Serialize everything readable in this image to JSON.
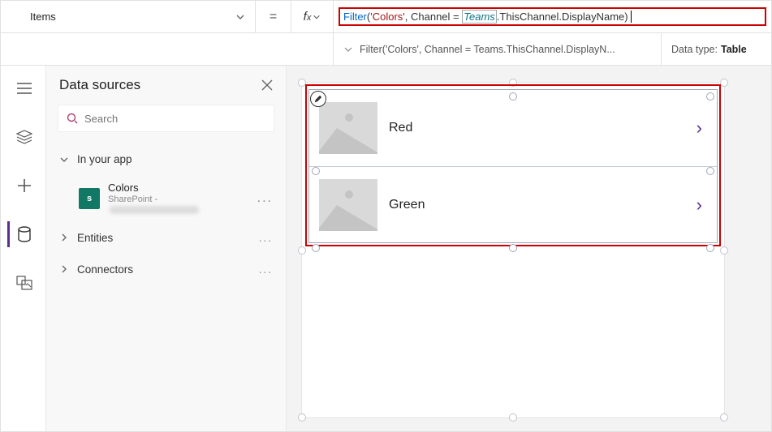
{
  "property": {
    "selected": "Items"
  },
  "formula": {
    "fn": "Filter",
    "arg1": "'Colors'",
    "argsep": ", Channel = ",
    "teamsToken": "Teams",
    "tail": ".ThisChannel.DisplayName)"
  },
  "status": {
    "expr": "Filter('Colors', Channel = Teams.ThisChannel.DisplayN...",
    "typeLabel": "Data type:",
    "typeValue": "Table"
  },
  "panel": {
    "title": "Data sources",
    "searchPlaceholder": "Search",
    "sections": {
      "inApp": "In your app",
      "entities": "Entities",
      "connectors": "Connectors"
    },
    "dataSource": {
      "name": "Colors",
      "subPrefix": "SharePoint - "
    }
  },
  "gallery": {
    "items": [
      {
        "title": "Red"
      },
      {
        "title": "Green"
      }
    ]
  },
  "chart_data": null
}
